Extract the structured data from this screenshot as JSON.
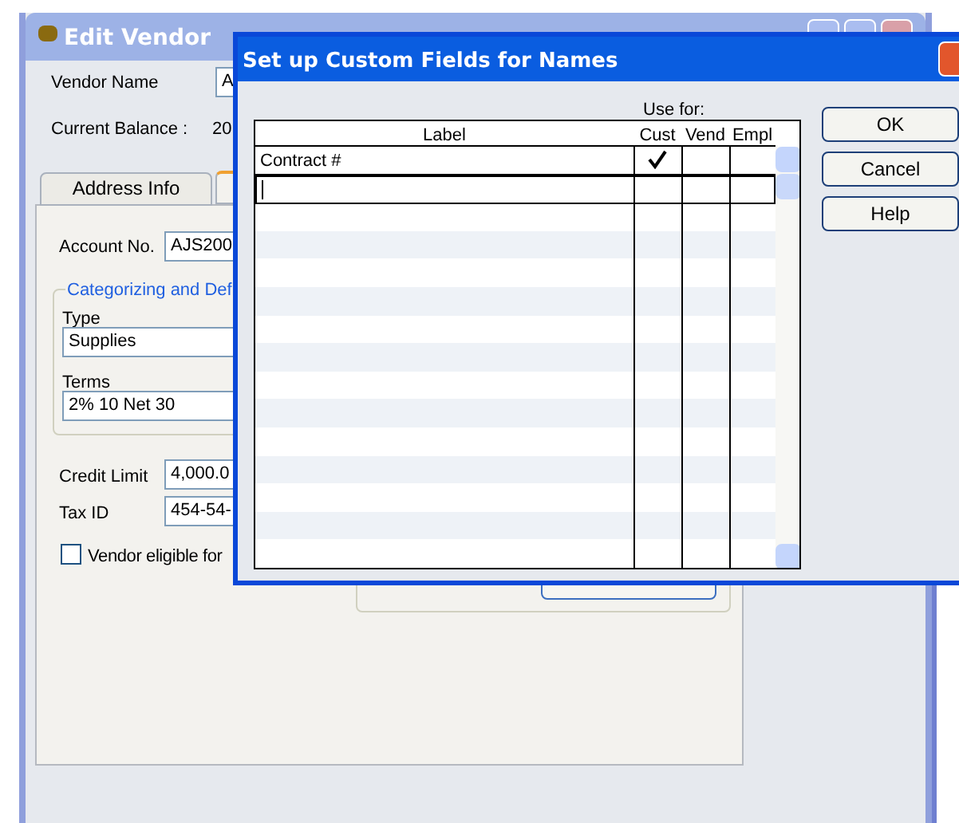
{
  "edit_vendor": {
    "title": "Edit Vendor",
    "vendor_name": {
      "label": "Vendor Name",
      "value": "A"
    },
    "current_balance": {
      "label": "Current Balance :",
      "value": "20"
    },
    "tabs": [
      {
        "label": "Address Info",
        "selected": false
      },
      {
        "selected": true
      }
    ],
    "account_no": {
      "label": "Account No.",
      "value": "AJS200"
    },
    "group": {
      "title": "Categorizing and Def",
      "type": {
        "label": "Type",
        "value": "Supplies"
      },
      "terms": {
        "label": "Terms",
        "value": "2% 10 Net 30"
      }
    },
    "credit_limit": {
      "label": "Credit Limit",
      "value": "4,000.0"
    },
    "tax_id": {
      "label": "Tax ID",
      "value": "454-54-"
    },
    "eligible": {
      "label": "Vendor eligible for",
      "checked": false
    }
  },
  "dialog": {
    "title": "Set up Custom Fields for Names",
    "use_for": "Use for:",
    "columns": [
      "Label",
      "Cust",
      "Vend",
      "Empl"
    ],
    "rows": [
      {
        "label": "Contract #",
        "cust": true,
        "vend": false,
        "empl": false,
        "selected": false
      },
      {
        "cust": false,
        "vend": false,
        "empl": false,
        "selected": true
      }
    ],
    "buttons": [
      "OK",
      "Cancel",
      "Help"
    ]
  }
}
